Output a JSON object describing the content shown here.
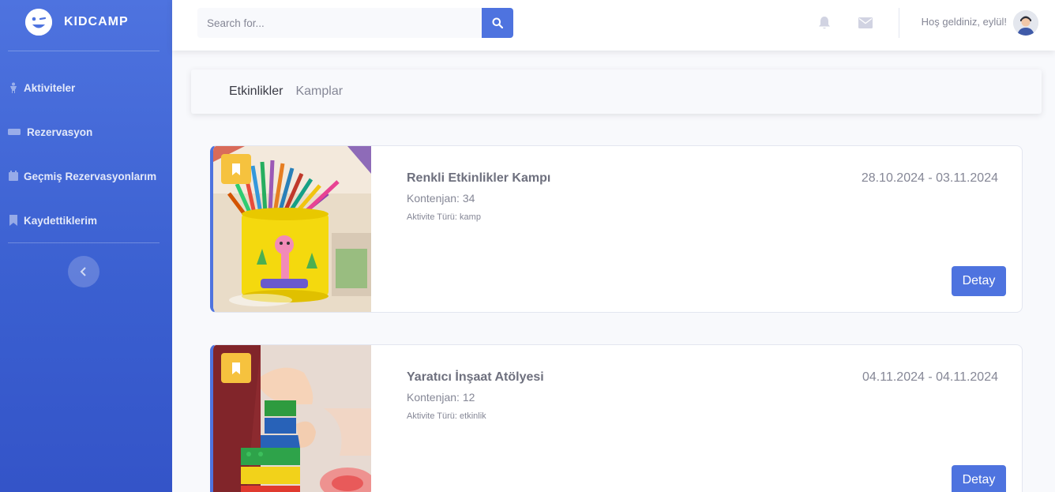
{
  "brand": {
    "name": "KIDCAMP"
  },
  "sidebar": {
    "items": [
      {
        "label": "Aktiviteler",
        "icon": "child-icon"
      },
      {
        "label": "Rezervasyon",
        "icon": "ticket-icon"
      },
      {
        "label": "Geçmiş Rezervasyonlarım",
        "icon": "calendar-icon"
      },
      {
        "label": "Kaydettiklerim",
        "icon": "bookmark-icon"
      }
    ]
  },
  "topbar": {
    "search_placeholder": "Search for...",
    "greeting": "Hoş geldiniz, eylül!"
  },
  "tabs": [
    {
      "label": "Etkinlikler",
      "active": true
    },
    {
      "label": "Kamplar",
      "active": false
    }
  ],
  "activities": [
    {
      "title": "Renkli Etkinlikler Kampı",
      "capacity": "Kontenjan: 34",
      "type": "Aktivite Türü: kamp",
      "dates": "28.10.2024 - 03.11.2024",
      "button": "Detay"
    },
    {
      "title": "Yaratıcı İnşaat Atölyesi",
      "capacity": "Kontenjan: 12",
      "type": "Aktivite Türü: etkinlik",
      "dates": "04.11.2024 - 04.11.2024",
      "button": "Detay"
    }
  ],
  "colors": {
    "primary": "#4e73df",
    "bookmark": "#f6c23e",
    "background": "#f8f9fc"
  }
}
